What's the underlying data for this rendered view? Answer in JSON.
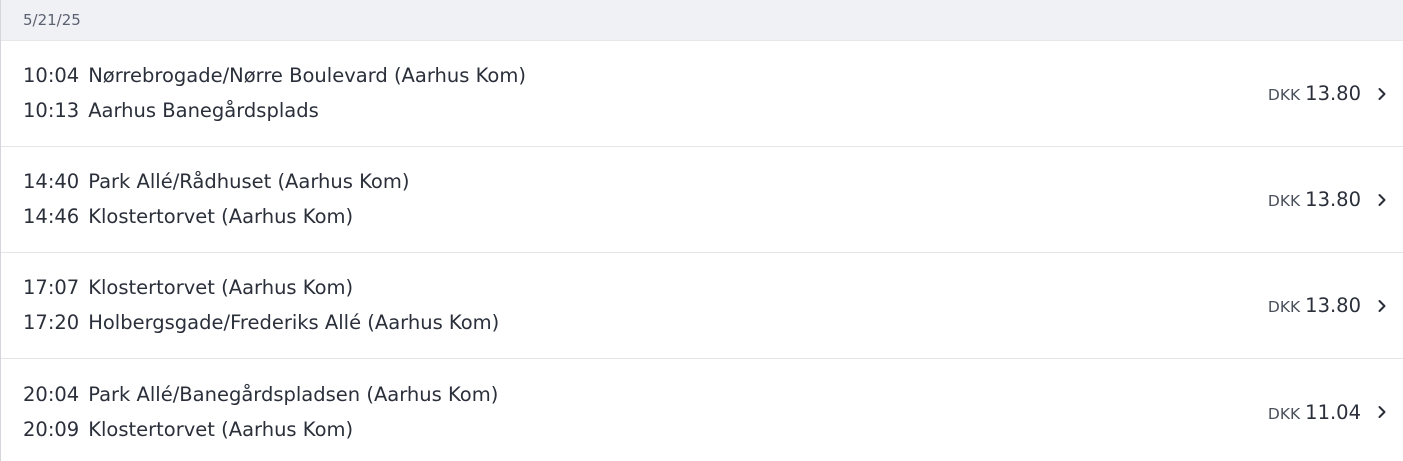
{
  "date_header": "5/21/25",
  "trips": [
    {
      "departure_time": "10:04",
      "departure_stop": "Nørrebrogade/Nørre Boulevard (Aarhus Kom)",
      "arrival_time": "10:13",
      "arrival_stop": "Aarhus Banegårdsplads",
      "currency": "DKK",
      "amount": "13.80"
    },
    {
      "departure_time": "14:40",
      "departure_stop": "Park Allé/Rådhuset (Aarhus Kom)",
      "arrival_time": "14:46",
      "arrival_stop": "Klostertorvet (Aarhus Kom)",
      "currency": "DKK",
      "amount": "13.80"
    },
    {
      "departure_time": "17:07",
      "departure_stop": "Klostertorvet (Aarhus Kom)",
      "arrival_time": "17:20",
      "arrival_stop": "Holbergsgade/Frederiks Allé (Aarhus Kom)",
      "currency": "DKK",
      "amount": "13.80"
    },
    {
      "departure_time": "20:04",
      "departure_stop": "Park Allé/Banegårdspladsen (Aarhus Kom)",
      "arrival_time": "20:09",
      "arrival_stop": "Klostertorvet (Aarhus Kom)",
      "currency": "DKK",
      "amount": "11.04"
    }
  ],
  "icons": {
    "row_chevron": "chevron-right-icon"
  },
  "colors": {
    "header_background": "#f0f1f5",
    "divider": "#e3e5e9",
    "text": "#2a2f3a"
  }
}
